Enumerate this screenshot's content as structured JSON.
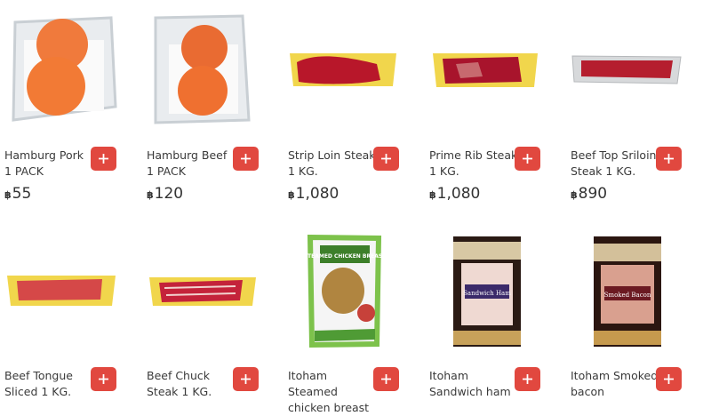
{
  "currency_symbol": "฿",
  "products": [
    {
      "name": "Hamburg Pork 1 PACK",
      "price": "55",
      "icon": "plus-icon"
    },
    {
      "name": "Hamburg Beef 1 PACK",
      "price": "120",
      "icon": "plus-icon"
    },
    {
      "name": "Strip Loin Steak 1 KG.",
      "price": "1,080",
      "icon": "plus-icon"
    },
    {
      "name": "Prime Rib Steak 1 KG.",
      "price": "1,080",
      "icon": "plus-icon"
    },
    {
      "name": "Beef Top Sriloin Steak 1 KG.",
      "price": "890",
      "icon": "plus-icon"
    },
    {
      "name": "Beef Tongue Sliced 1 KG.",
      "icon": "plus-icon"
    },
    {
      "name": "Beef Chuck Steak 1 KG.",
      "icon": "plus-icon"
    },
    {
      "name": "Itoham Steamed chicken breast",
      "icon": "plus-icon"
    },
    {
      "name": "Itoham Sandwich ham",
      "icon": "plus-icon"
    },
    {
      "name": "Itoham Smoked bacon",
      "icon": "plus-icon"
    }
  ],
  "package_labels": {
    "steamed": "STEAMED CHICKEN BREAST",
    "sandwich": "Sandwich Ham",
    "bacon": "Smoked Bacon"
  }
}
